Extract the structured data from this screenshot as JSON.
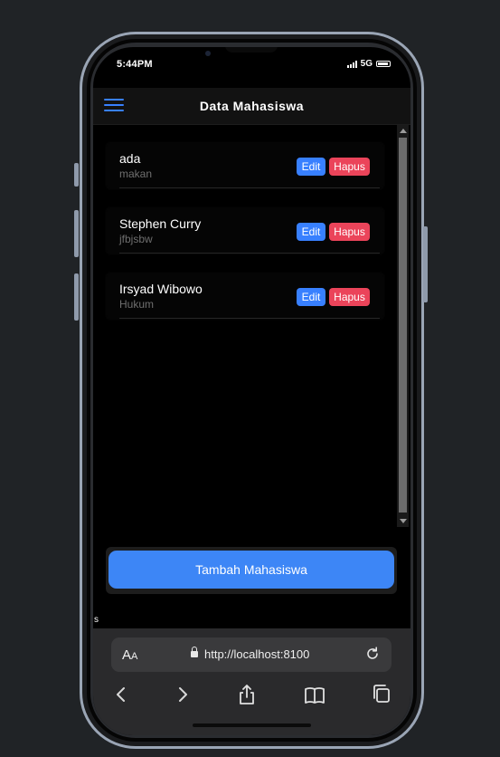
{
  "status_bar": {
    "time": "5:44PM",
    "network": "5G"
  },
  "toolbar": {
    "title": "Data Mahasiswa"
  },
  "students": [
    {
      "name": "ada",
      "major": "makan"
    },
    {
      "name": "Stephen Curry",
      "major": "jfbjsbw"
    },
    {
      "name": "Irsyad Wibowo",
      "major": "Hukum"
    }
  ],
  "actions": {
    "edit_label": "Edit",
    "delete_label": "Hapus"
  },
  "footer": {
    "add_label": "Tambah Mahasiswa"
  },
  "stray_text": "s",
  "browser": {
    "text_size_label": "A",
    "text_size_small": "A",
    "url": "http://localhost:8100"
  },
  "colors": {
    "primary": "#3880ff",
    "danger": "#eb445a",
    "background": "#000000",
    "add_button": "#3d86f6"
  },
  "icons": [
    "menu-icon",
    "lock-icon",
    "reload-icon",
    "back-icon",
    "forward-icon",
    "share-icon",
    "bookmarks-icon",
    "tabs-icon"
  ]
}
